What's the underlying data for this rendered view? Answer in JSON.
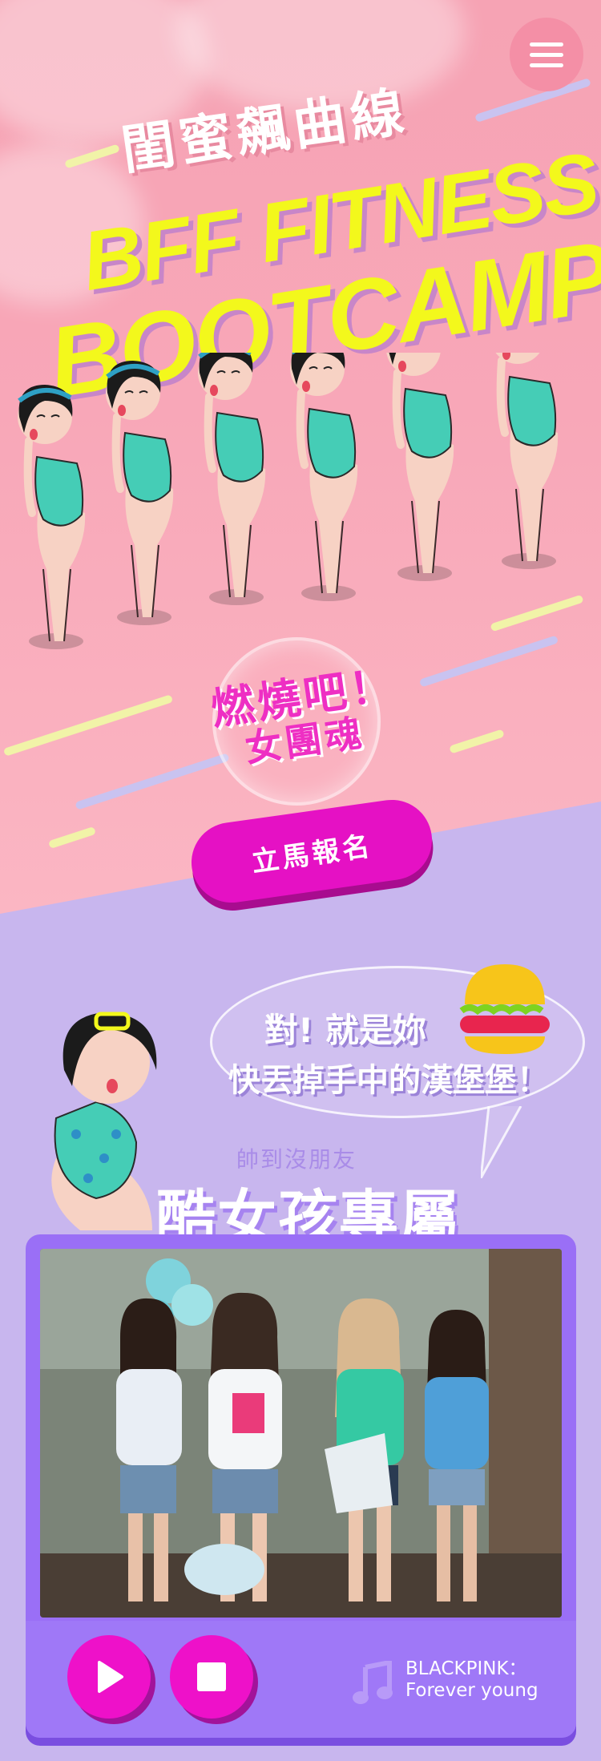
{
  "hero": {
    "title_cn": "閨蜜飆曲線",
    "title_en_line1": "BFF FITNESS",
    "title_en_line2": "BOOTCAMP!",
    "slogan_line1": "燃燒吧！",
    "slogan_line2": "女團魂",
    "signup_label": "立馬報名"
  },
  "menu": {
    "icon": "hamburger-menu-icon"
  },
  "section2": {
    "bubble_line1": "對! 就是妳",
    "bubble_line2": "快丟掉手中的漢堡堡！",
    "subtitle": "帥到沒朋友",
    "title": "酷女孩專屬"
  },
  "player": {
    "artist": "BLACKPINK：",
    "song": "Forever young",
    "play_icon": "play-icon",
    "stop_icon": "stop-icon",
    "music_icon": "music-note-icon"
  },
  "colors": {
    "hero_bg": "#f6a3b4",
    "section_bg": "#c8b6ee",
    "accent_magenta": "#e511c4",
    "title_yellow": "#f3f81c",
    "player_purple": "#9a6ff6"
  }
}
